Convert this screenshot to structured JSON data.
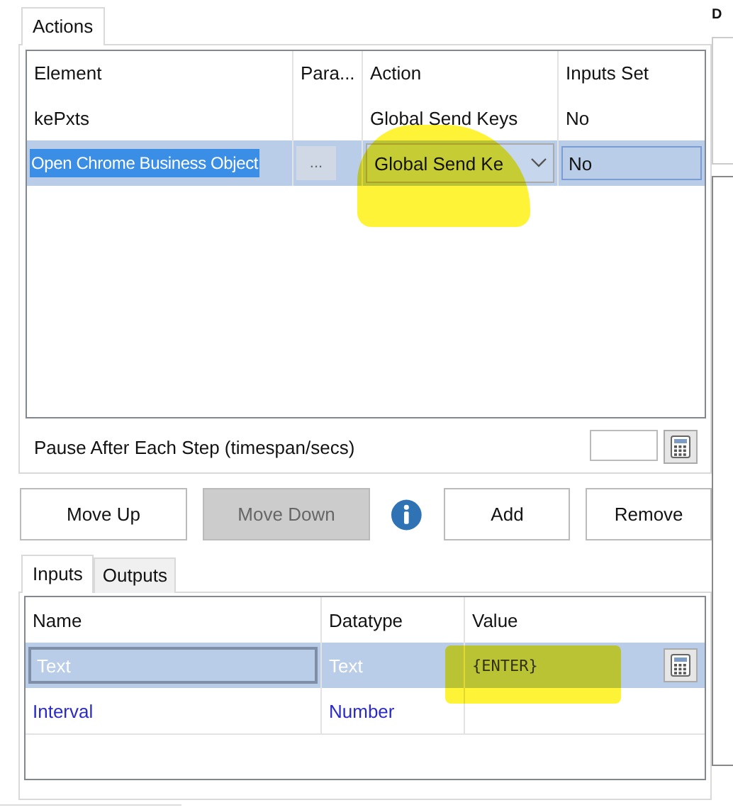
{
  "actions_tab": {
    "label": "Actions",
    "selected": true
  },
  "actions_table": {
    "columns": [
      "Element",
      "Para...",
      "Action",
      "Inputs Set"
    ],
    "rows": [
      {
        "element": "kePxts",
        "action": "Global Send Keys",
        "inputs_set": "No",
        "selected": false
      },
      {
        "element": "Open Chrome Business Object",
        "param_button": "...",
        "action": "Global Send Ke",
        "inputs_set": "No",
        "selected": true
      }
    ]
  },
  "pause": {
    "label": "Pause After Each Step (timespan/secs)"
  },
  "buttons": [
    {
      "kind": "button",
      "label": "Move Up",
      "disabled": false
    },
    {
      "kind": "button",
      "label": "Move Down",
      "disabled": true
    },
    {
      "kind": "info"
    },
    {
      "kind": "button",
      "label": "Add",
      "disabled": false
    },
    {
      "kind": "button",
      "label": "Remove",
      "disabled": false
    }
  ],
  "io_tabs": [
    {
      "label": "Inputs",
      "selected": true
    },
    {
      "label": "Outputs",
      "selected": false
    }
  ],
  "inputs_table": {
    "columns": [
      "Name",
      "Datatype",
      "Value"
    ],
    "rows": [
      {
        "name": "Text",
        "datatype": "Text",
        "value": "{ENTER}",
        "selected": true
      },
      {
        "name": "Interval",
        "datatype": "Number",
        "selected": false
      }
    ]
  },
  "side_panel": {
    "label": "D"
  }
}
